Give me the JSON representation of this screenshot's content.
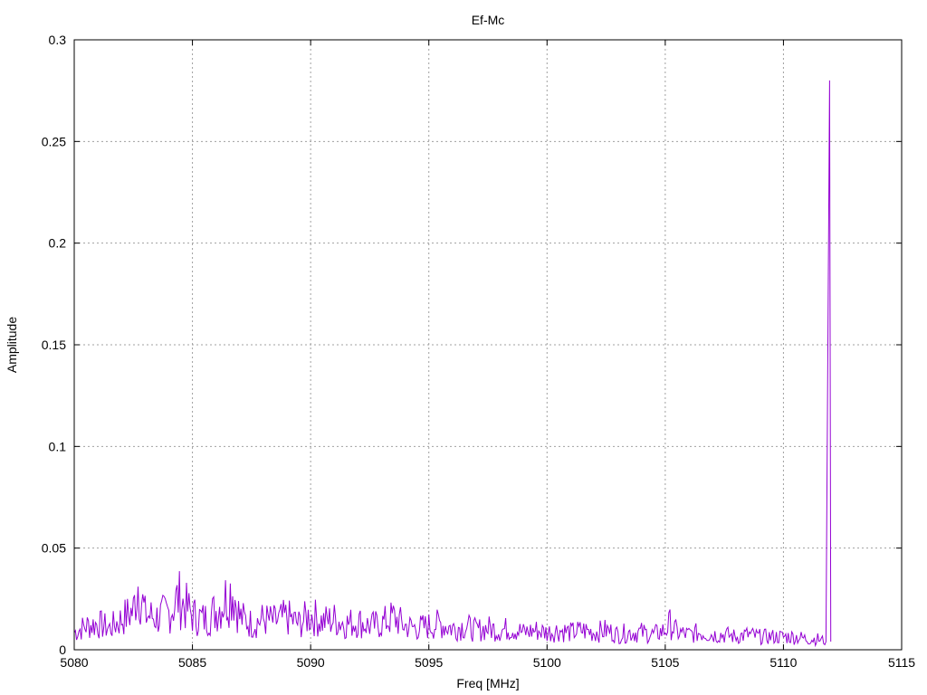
{
  "chart_data": {
    "type": "line",
    "title": "Ef-Mc",
    "xlabel": "Freq [MHz]",
    "ylabel": "Amplitude",
    "xlim": [
      5080,
      5115
    ],
    "ylim": [
      0,
      0.3
    ],
    "xticks": [
      "5080",
      "5085",
      "5090",
      "5095",
      "5100",
      "5105",
      "5110",
      "5115"
    ],
    "yticks": [
      "0",
      "0.05",
      "0.1",
      "0.15",
      "0.2",
      "0.25",
      "0.3"
    ],
    "grid": true,
    "legend": "none",
    "series": [
      {
        "color": "#9400d3",
        "x": [
          5080.0,
          5080.5,
          5081.0,
          5081.5,
          5082.0,
          5082.5,
          5082.7,
          5083.0,
          5083.5,
          5084.0,
          5084.4,
          5085.0,
          5085.5,
          5086.0,
          5086.7,
          5087.0,
          5087.5,
          5088.0,
          5088.5,
          5089.0,
          5089.5,
          5090.0,
          5090.5,
          5091.0,
          5091.5,
          5092.0,
          5092.5,
          5093.0,
          5093.5,
          5094.0,
          5094.5,
          5095.0,
          5095.5,
          5096.0,
          5096.5,
          5097.0,
          5097.5,
          5098.0,
          5098.5,
          5099.0,
          5099.5,
          5100.0,
          5100.5,
          5101.0,
          5101.5,
          5102.0,
          5102.5,
          5103.0,
          5103.5,
          5104.0,
          5104.5,
          5105.0,
          5105.2,
          5105.5,
          5106.0,
          5106.5,
          5107.0,
          5107.5,
          5108.0,
          5108.5,
          5109.0,
          5109.5,
          5110.0,
          5110.5,
          5111.0,
          5111.4,
          5111.8,
          5111.95,
          5112.0
        ],
        "y": [
          0.008,
          0.011,
          0.012,
          0.01,
          0.014,
          0.018,
          0.031,
          0.016,
          0.015,
          0.017,
          0.024,
          0.016,
          0.014,
          0.018,
          0.028,
          0.015,
          0.012,
          0.014,
          0.013,
          0.015,
          0.012,
          0.016,
          0.013,
          0.014,
          0.012,
          0.013,
          0.011,
          0.012,
          0.015,
          0.011,
          0.01,
          0.011,
          0.012,
          0.01,
          0.011,
          0.009,
          0.01,
          0.009,
          0.01,
          0.008,
          0.009,
          0.008,
          0.009,
          0.008,
          0.009,
          0.008,
          0.009,
          0.007,
          0.008,
          0.008,
          0.007,
          0.009,
          0.012,
          0.008,
          0.007,
          0.008,
          0.007,
          0.007,
          0.006,
          0.007,
          0.006,
          0.006,
          0.006,
          0.006,
          0.005,
          0.005,
          0.004,
          0.28,
          0.004
        ]
      }
    ]
  }
}
